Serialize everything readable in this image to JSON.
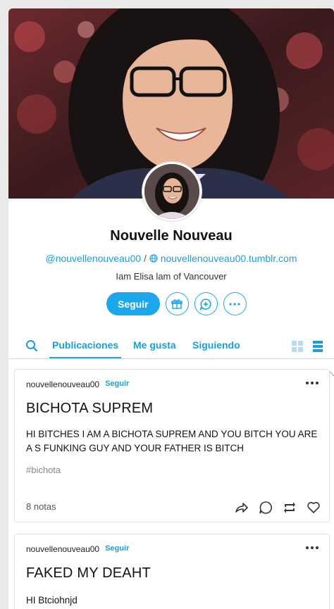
{
  "blog": {
    "title": "Nouvelle Nouveau",
    "handle": "@nouvellenouveau00",
    "separator": "/",
    "url": "nouvellenouveau00.tumblr.com",
    "description": "Iam Elisa lam of Vancouver",
    "follow_label": "Seguir"
  },
  "tabs": [
    {
      "label": "Publicaciones",
      "active": true
    },
    {
      "label": "Me gusta",
      "active": false
    },
    {
      "label": "Siguiendo",
      "active": false
    }
  ],
  "posts": [
    {
      "blogname": "nouvellenouveau00",
      "follow": "Seguir",
      "title": "BICHOTA SUPREM",
      "body": "HI BITCHES I AM A BICHOTA SUPREM AND YOU BITCH YOU ARE A S FUNKING GUY AND YOUR FATHER IS BITCH",
      "tag": "#bichota",
      "notes": "8 notas"
    },
    {
      "blogname": "nouvellenouveau00",
      "follow": "Seguir",
      "title": "FAKED MY DEAHT",
      "body": "HI Btciohnjd"
    }
  ],
  "colors": {
    "accent": "#1aa7ec",
    "link": "#1a9ed8"
  },
  "icons": [
    "globe-icon",
    "gift-icon",
    "chat-plus-icon",
    "more-icon",
    "search-icon",
    "grid-view-icon",
    "list-view-icon",
    "share-icon",
    "reply-icon",
    "reblog-icon",
    "like-icon"
  ]
}
